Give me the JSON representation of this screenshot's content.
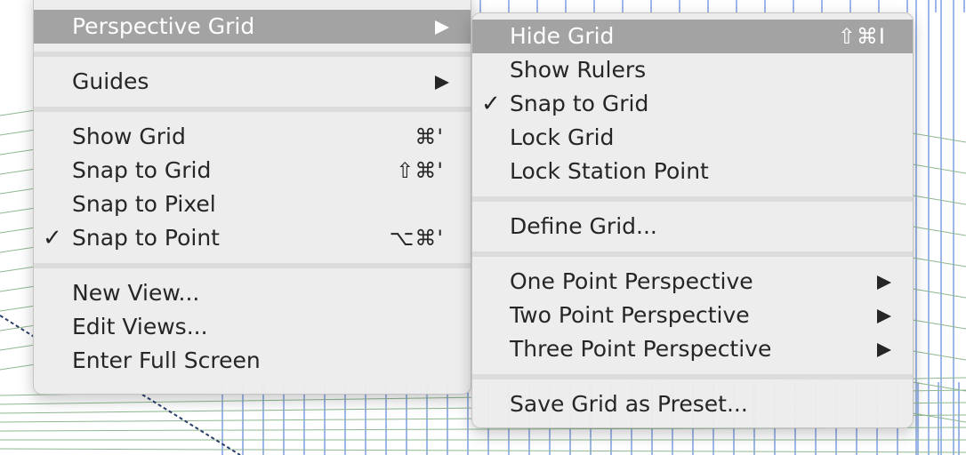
{
  "main_menu": {
    "items": [
      {
        "label": "Perspective Grid",
        "submenu": true,
        "highlighted": true
      },
      {
        "label": "Guides",
        "submenu": true
      },
      {
        "label": "Show Grid",
        "shortcut": "⌘'"
      },
      {
        "label": "Snap to Grid",
        "shortcut": "⇧⌘'"
      },
      {
        "label": "Snap to Pixel"
      },
      {
        "label": "Snap to Point",
        "shortcut": "⌥⌘'",
        "checked": true,
        "check_mark": "✓"
      },
      {
        "label": "New View..."
      },
      {
        "label": "Edit Views..."
      },
      {
        "label": "Enter Full Screen"
      }
    ]
  },
  "submenu": {
    "items": [
      {
        "label": "Hide Grid",
        "shortcut": "⇧⌘I",
        "highlighted": true
      },
      {
        "label": "Show Rulers"
      },
      {
        "label": "Snap to Grid",
        "checked": true,
        "check_mark": "✓"
      },
      {
        "label": "Lock Grid"
      },
      {
        "label": "Lock Station Point"
      },
      {
        "label": "Define Grid..."
      },
      {
        "label": "One Point Perspective",
        "submenu": true
      },
      {
        "label": "Two Point Perspective",
        "submenu": true
      },
      {
        "label": "Three Point Perspective",
        "submenu": true
      },
      {
        "label": "Save Grid as Preset..."
      }
    ]
  },
  "colors": {
    "menu_background": "#ececec",
    "highlight": "#a3a3a3",
    "text": "#262626",
    "grid_blue": "#3d6fd6",
    "grid_green": "#8fb88f",
    "grid_dark": "#2a3f6b"
  },
  "icons": {
    "submenu_arrow": "triangle-right-icon",
    "checkmark": "checkmark-icon"
  }
}
